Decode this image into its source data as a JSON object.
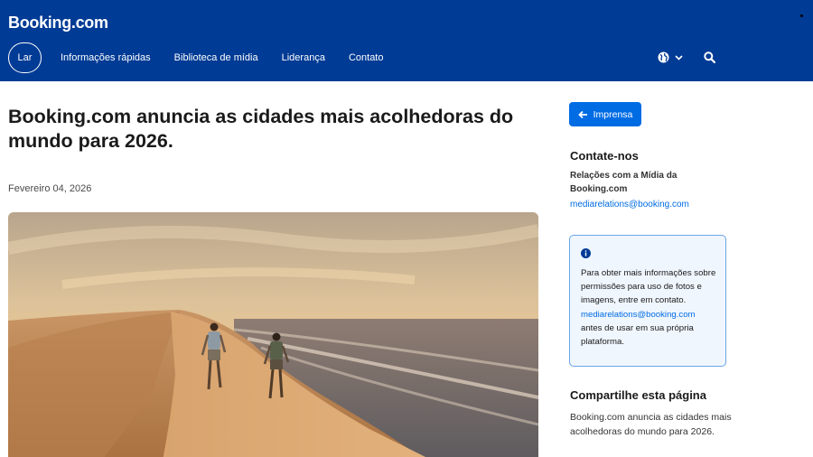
{
  "header": {
    "logo": "Booking.com",
    "nav": {
      "home": "Lar",
      "links": [
        "Informações rápidas",
        "Biblioteca de mídia",
        "Liderança",
        "Contato"
      ]
    },
    "icons": {
      "language": "globe-icon",
      "dropdown": "chevron-down-icon",
      "search": "search-icon"
    }
  },
  "article": {
    "title": "Booking.com anuncia as cidades mais acolhedoras do mundo para 2026.",
    "date": "Fevereiro 04, 2026"
  },
  "sidebar": {
    "back_button": "Imprensa",
    "contact": {
      "title": "Contate-nos",
      "subtitle": "Relações com a Mídia da Booking.com",
      "email": "mediarelations@booking.com"
    },
    "info": {
      "text": "Para obter mais informações sobre permissões para uso de fotos e imagens, entre em contato.",
      "email": "mediarelations@booking.com",
      "text2": "antes de usar em sua própria plataforma."
    },
    "share": {
      "title": "Compartilhe esta página",
      "text": "Booking.com anuncia as cidades mais acolhedoras do mundo para 2026."
    }
  },
  "colors": {
    "header_bg": "#003b95",
    "accent": "#006ce4",
    "info_bg": "#f0f6fe"
  }
}
